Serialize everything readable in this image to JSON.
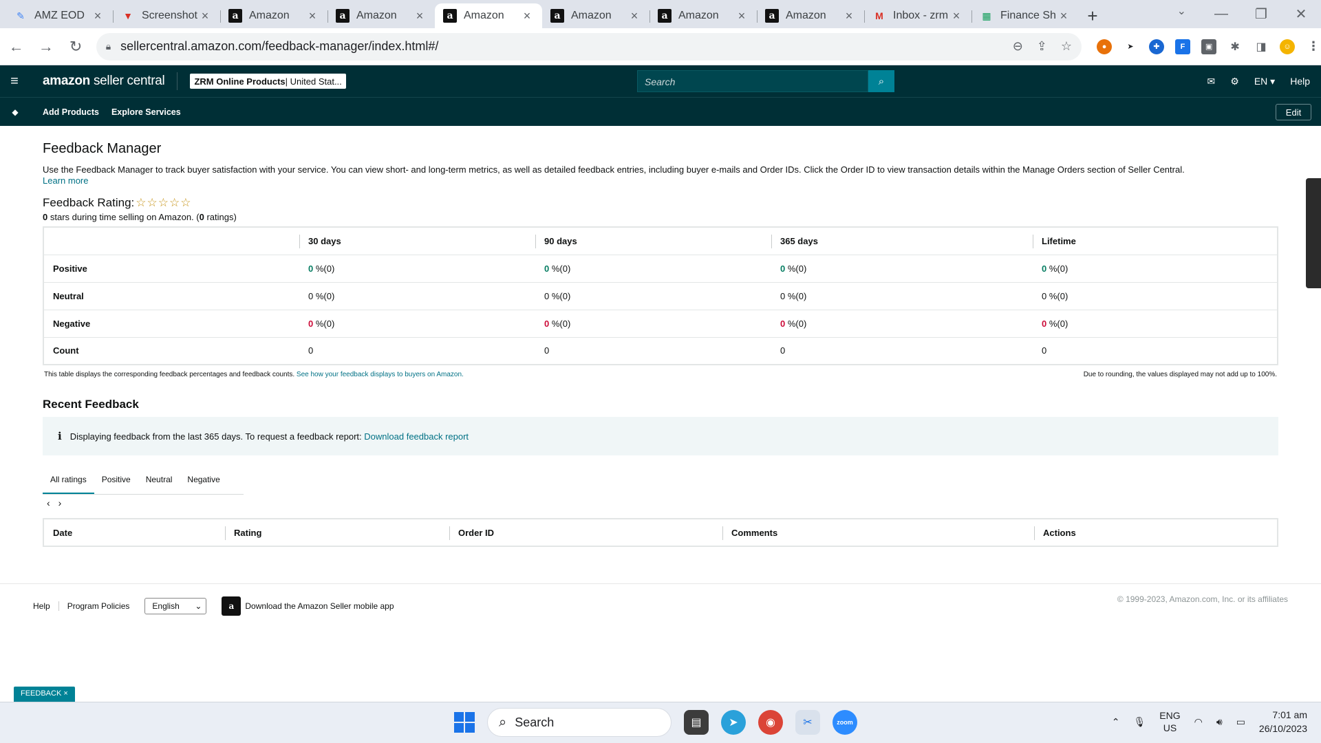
{
  "browser": {
    "tabs": [
      {
        "label": "AMZ EOD",
        "icon": "pencil-icon",
        "active": false
      },
      {
        "label": "Screenshot",
        "icon": "screenshot-icon",
        "active": false
      },
      {
        "label": "Amazon",
        "icon": "amazon-icon",
        "active": false
      },
      {
        "label": "Amazon",
        "icon": "amazon-icon",
        "active": false
      },
      {
        "label": "Amazon",
        "icon": "amazon-icon",
        "active": true
      },
      {
        "label": "Amazon",
        "icon": "amazon-icon",
        "active": false
      },
      {
        "label": "Amazon",
        "icon": "amazon-icon",
        "active": false
      },
      {
        "label": "Amazon",
        "icon": "amazon-icon",
        "active": false
      },
      {
        "label": "Inbox - zrm",
        "icon": "gmail-icon",
        "active": false
      },
      {
        "label": "Finance Sh",
        "icon": "sheets-icon",
        "active": false
      }
    ],
    "url": "sellercentral.amazon.com/feedback-manager/index.html#/"
  },
  "header": {
    "logo_main": "amazon",
    "logo_sub": "seller central",
    "account_bold": "ZRM Online Products",
    "account_rest": " | United Stat...",
    "search_placeholder": "Search",
    "lang": "EN",
    "help": "Help"
  },
  "subnav": {
    "items": [
      "Add Products",
      "Explore Services"
    ],
    "edit": "Edit"
  },
  "page": {
    "title": "Feedback Manager",
    "description": "Use the Feedback Manager to track buyer satisfaction with your service. You can view short- and long-term metrics, as well as detailed feedback entries, including buyer e-mails and Order IDs. Click the Order ID to view transaction details within the Manage Orders section of Seller Central.",
    "learn_more": "Learn more",
    "rating_title": "Feedback Rating:",
    "stars": "☆☆☆☆☆",
    "rating_count_stars": "0",
    "rating_mid": " stars during time selling on Amazon. (",
    "rating_count_ratings": "0",
    "rating_end": " ratings)"
  },
  "feedback_table": {
    "columns": [
      "30 days",
      "90 days",
      "365 days",
      "Lifetime"
    ],
    "rows": [
      {
        "label": "Positive",
        "values": [
          "0",
          "0",
          "0",
          "0"
        ],
        "suffix": " %(0)",
        "color": "#067d62"
      },
      {
        "label": "Neutral",
        "values": [
          "0",
          "0",
          "0",
          "0"
        ],
        "suffix": " %(0)",
        "color": "#0f1111"
      },
      {
        "label": "Negative",
        "values": [
          "0",
          "0",
          "0",
          "0"
        ],
        "suffix": " %(0)",
        "color": "#cc0c39"
      },
      {
        "label": "Count",
        "values": [
          "0",
          "0",
          "0",
          "0"
        ],
        "suffix": "",
        "color": "#0f1111"
      }
    ],
    "note_left": "This table displays the corresponding feedback percentages and feedback counts.",
    "note_link": "See how your feedback displays to buyers on Amazon.",
    "note_right": "Due to rounding, the values displayed may not add up to 100%."
  },
  "recent": {
    "title": "Recent Feedback",
    "info_text": "Displaying feedback from the last 365 days. To request a feedback report:",
    "info_link": "Download feedback report",
    "tabs": [
      "All ratings",
      "Positive",
      "Neutral",
      "Negative"
    ],
    "selected_tab": "All ratings",
    "columns": [
      "Date",
      "Rating",
      "Order ID",
      "Comments",
      "Actions"
    ]
  },
  "footer": {
    "links": [
      "Help",
      "Program Policies"
    ],
    "language": "English",
    "app_text": "Download the Amazon Seller mobile app",
    "copyright": "© 1999-2023, Amazon.com, Inc. or its affiliates"
  },
  "feedback_badge": "FEEDBACK ×",
  "taskbar": {
    "search": "Search",
    "lang_top": "ENG",
    "lang_bottom": "US",
    "time": "7:01 am",
    "date": "26/10/2023"
  },
  "colors": {
    "header_bg": "#002f36",
    "accent": "#008296",
    "link": "#007185",
    "positive": "#067d62",
    "negative": "#cc0c39"
  }
}
